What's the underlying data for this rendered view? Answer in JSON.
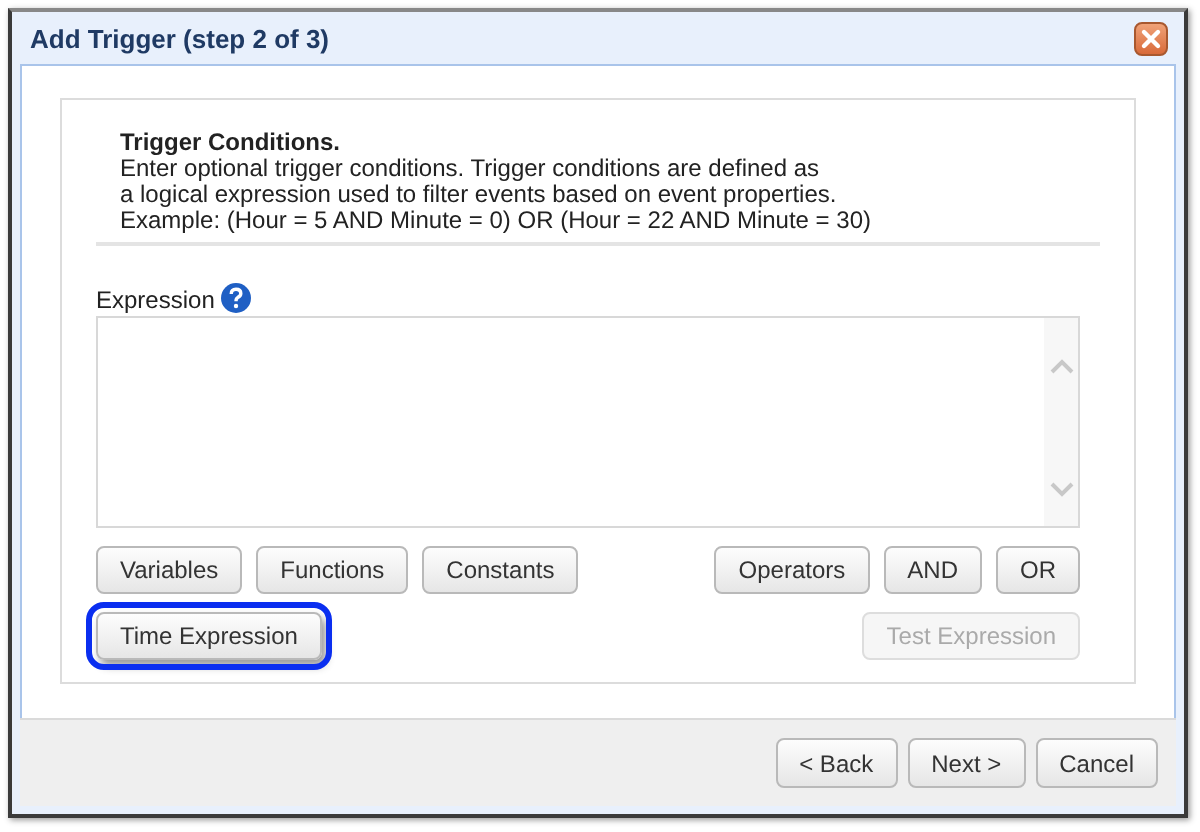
{
  "window": {
    "title": "Add Trigger (step 2 of 3)"
  },
  "intro": {
    "heading": "Trigger Conditions.",
    "lines": [
      "Enter optional trigger conditions. Trigger conditions are defined as",
      "a logical expression used to filter events based on event properties.",
      "Example: (Hour = 5 AND Minute = 0) OR (Hour = 22 AND Minute = 30)"
    ]
  },
  "expression": {
    "label": "Expression"
  },
  "button_rows": [
    {
      "left": [
        {
          "label": "Variables",
          "disabled": false,
          "highlighted": false
        },
        {
          "label": "Functions",
          "disabled": false,
          "highlighted": false
        },
        {
          "label": "Constants",
          "disabled": false,
          "highlighted": false
        }
      ],
      "right": [
        {
          "label": "Operators",
          "disabled": false,
          "highlighted": false
        },
        {
          "label": "AND",
          "disabled": false,
          "highlighted": false
        },
        {
          "label": "OR",
          "disabled": false,
          "highlighted": false
        }
      ]
    },
    {
      "left": [
        {
          "label": "Time Expression",
          "disabled": false,
          "highlighted": true
        }
      ],
      "right": [
        {
          "label": "Test Expression",
          "disabled": true,
          "highlighted": false
        }
      ]
    }
  ],
  "footer_buttons": [
    "< Back",
    "Next >",
    "Cancel"
  ]
}
